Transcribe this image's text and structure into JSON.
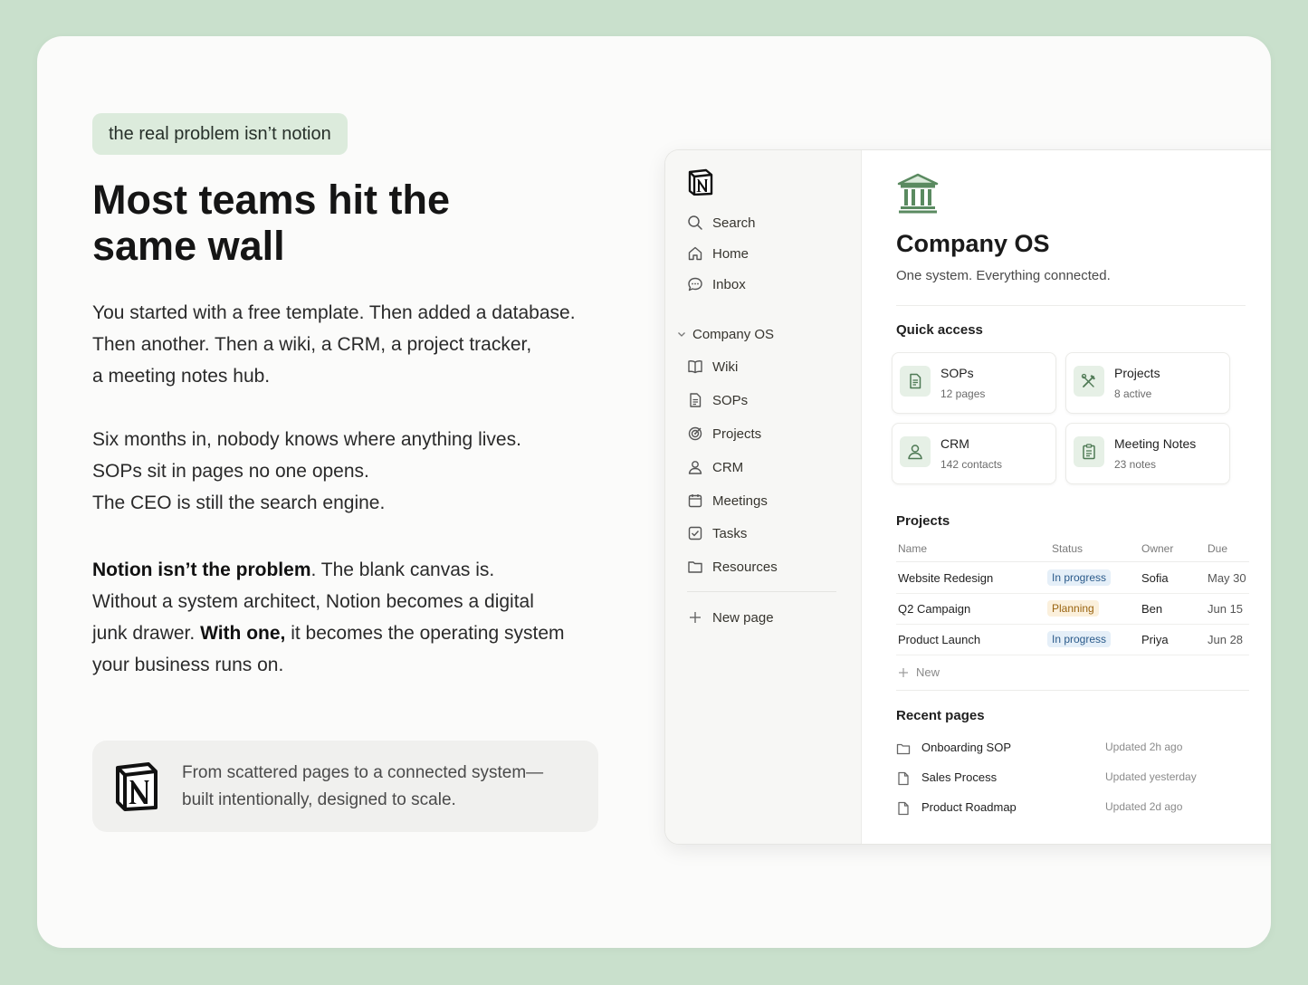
{
  "hero": {
    "tag": "the real problem isn’t notion",
    "headline": "Most teams hit the same wall",
    "p1": [
      "You started with a free template. Then added a database.",
      "Then another. Then a wiki, a CRM, a project tracker,",
      "a meeting notes hub."
    ],
    "p2": [
      "Six months in, nobody knows where anything lives.",
      "SOPs sit in pages no one opens.",
      "The CEO is still the search engine."
    ],
    "p3": {
      "bold1": "Notion isn’t the problem",
      "text1": ". The blank canvas is.",
      "text2": "Without a system architect, Notion becomes a digital",
      "text3": "junk drawer. ",
      "bold2": "With one,",
      "text4": " it becomes the operating system",
      "text5": "your business runs on."
    },
    "quote": [
      "From scattered pages to a connected system—",
      "built intentionally, designed to scale."
    ]
  },
  "sidebar": {
    "top": [
      {
        "label": "Search",
        "icon": "search-icon"
      },
      {
        "label": "Home",
        "icon": "home-icon"
      },
      {
        "label": "Inbox",
        "icon": "inbox-icon"
      }
    ],
    "section": "Company OS",
    "items": [
      {
        "label": "Wiki",
        "icon": "book-icon"
      },
      {
        "label": "SOPs",
        "icon": "document-icon"
      },
      {
        "label": "Projects",
        "icon": "target-icon"
      },
      {
        "label": "CRM",
        "icon": "user-icon"
      },
      {
        "label": "Meetings",
        "icon": "calendar-icon"
      },
      {
        "label": "Tasks",
        "icon": "checkbox-icon"
      },
      {
        "label": "Resources",
        "icon": "folder-icon"
      }
    ],
    "new_page": "New page"
  },
  "main": {
    "title": "Company OS",
    "subtitle": "One system. Everything connected.",
    "quick_access_title": "Quick access",
    "quick_access": [
      {
        "title": "SOPs",
        "sub": "12 pages",
        "icon": "document-icon"
      },
      {
        "title": "Projects",
        "sub": "8 active",
        "icon": "tools-icon"
      },
      {
        "title": "CRM",
        "sub": "142 contacts",
        "icon": "user-icon"
      },
      {
        "title": "Meeting Notes",
        "sub": "23 notes",
        "icon": "notes-icon"
      }
    ],
    "projects_title": "Projects",
    "columns": [
      "Name",
      "Status",
      "Owner",
      "Due"
    ],
    "rows": [
      {
        "name": "Website Redesign",
        "status": "In progress",
        "owner": "Sofia",
        "due": "May 30"
      },
      {
        "name": "Q2 Campaign",
        "status": "Planning",
        "owner": "Ben",
        "due": "Jun 15"
      },
      {
        "name": "Product Launch",
        "status": "In progress",
        "owner": "Priya",
        "due": "Jun 28"
      }
    ],
    "new_label": "New",
    "recent_title": "Recent pages",
    "recent": [
      {
        "name": "Onboarding SOP",
        "updated": "Updated 2h ago",
        "icon": "folder-icon"
      },
      {
        "name": "Sales Process",
        "updated": "Updated yesterday",
        "icon": "page-icon"
      },
      {
        "name": "Product Roadmap",
        "updated": "Updated 2d ago",
        "icon": "page-icon"
      }
    ]
  },
  "colors": {
    "background": "#c9e0cc",
    "accent_green": "#5a8a60",
    "status_progress": "#2a5a8a",
    "status_planning": "#9a6410"
  }
}
